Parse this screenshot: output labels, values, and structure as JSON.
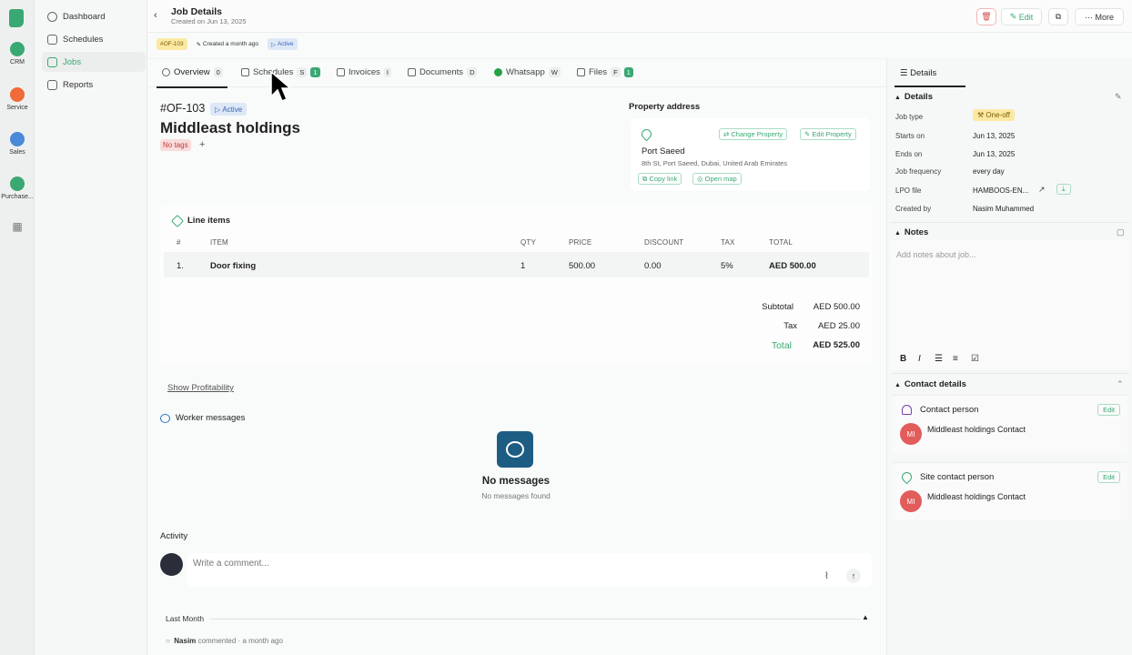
{
  "rail": {
    "items": [
      {
        "label": "CRM",
        "color": "#3aa872"
      },
      {
        "label": "Service",
        "color": "#ef6b3a"
      },
      {
        "label": "Sales",
        "color": "#4a8ad8"
      },
      {
        "label": "Purchase...",
        "color": "#3aa872"
      }
    ]
  },
  "nav": {
    "items": [
      {
        "label": "Dashboard",
        "icon": "dashboard-icon"
      },
      {
        "label": "Schedules",
        "icon": "calendar-icon"
      },
      {
        "label": "Jobs",
        "icon": "jobs-icon",
        "active": true
      },
      {
        "label": "Reports",
        "icon": "reports-icon"
      }
    ]
  },
  "header": {
    "back": "‹",
    "title": "Job Details",
    "subtitle": "Created on Jun 13, 2025",
    "edit_label": "Edit",
    "more_label": "More"
  },
  "chips": {
    "id": "#OF-103",
    "created": "Created a month ago",
    "status": "Active"
  },
  "tabs": [
    {
      "label": "Overview",
      "badge": "0"
    },
    {
      "label": "Schedules",
      "badge": "S",
      "badge2": "1"
    },
    {
      "label": "Invoices",
      "badge": "I"
    },
    {
      "label": "Documents",
      "badge": "D"
    },
    {
      "label": "Whatsapp",
      "badge": "W"
    },
    {
      "label": "Files",
      "badge": "F",
      "badge2": "1"
    }
  ],
  "job": {
    "id": "#OF-103",
    "status": "Active",
    "name": "Middleast holdings",
    "no_tags": "No tags",
    "add_tag": "+"
  },
  "property": {
    "heading": "Property address",
    "change": "Change Property",
    "edit": "Edit Property",
    "name": "Port Saeed",
    "address": "8th St, Port Saeed, Dubai, United Arab Emirates",
    "copy_link": "Copy link",
    "open_map": "Open map"
  },
  "line_items": {
    "heading": "Line items",
    "columns": [
      "#",
      "ITEM",
      "QTY",
      "PRICE",
      "DISCOUNT",
      "TAX",
      "TOTAL"
    ],
    "rows": [
      {
        "num": "1.",
        "item": "Door fixing",
        "qty": "1",
        "price": "500.00",
        "discount": "0.00",
        "tax": "5%",
        "total": "AED 500.00"
      }
    ],
    "subtotal_label": "Subtotal",
    "subtotal": "AED 500.00",
    "tax_label": "Tax",
    "tax": "AED 25.00",
    "total_label": "Total",
    "total": "AED 525.00"
  },
  "show_profitability": "Show Profitability",
  "worker_messages": {
    "heading": "Worker messages",
    "empty_title": "No messages",
    "empty_sub": "No messages found"
  },
  "activity": {
    "heading": "Activity",
    "placeholder": "Write a comment...",
    "group": "Last Month",
    "entry_user": "Nasim",
    "entry_text": "commented · a month ago"
  },
  "right": {
    "tab": "Details",
    "details_heading": "Details",
    "fields": [
      {
        "label": "Job type",
        "value": "One-off"
      },
      {
        "label": "Starts on",
        "value": "Jun 13, 2025"
      },
      {
        "label": "Ends on",
        "value": "Jun 13, 2025"
      },
      {
        "label": "Job frequency",
        "value": "every day"
      },
      {
        "label": "LPO file",
        "value": "HAMBOOS-EN..."
      },
      {
        "label": "Created by",
        "value": "Nasim Muhammed"
      }
    ],
    "notes_heading": "Notes",
    "notes_placeholder": "Add notes about job...",
    "contact_heading": "Contact details",
    "contact_person_label": "Contact person",
    "contact_person_name": "Middleast holdings Contact",
    "site_contact_label": "Site contact person",
    "site_contact_name": "Middleast holdings Contact",
    "edit_label": "Edit",
    "avatar_initials": "MI"
  }
}
